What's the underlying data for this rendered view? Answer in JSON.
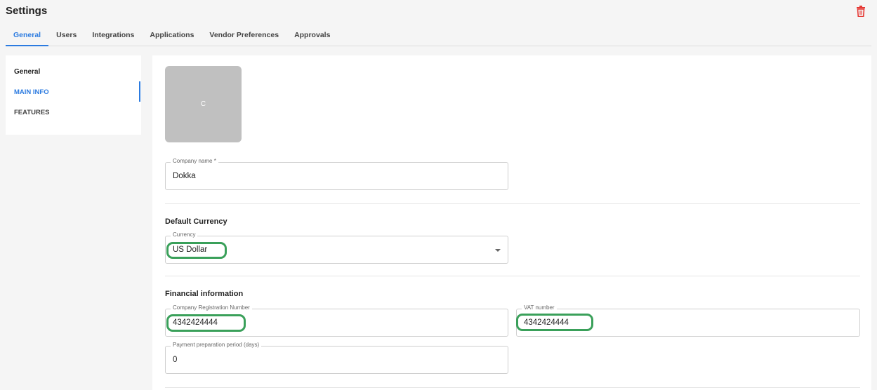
{
  "header": {
    "title": "Settings",
    "delete_icon": "trash-icon",
    "delete_icon_color": "#e53935"
  },
  "tabs": [
    {
      "label": "General",
      "active": true
    },
    {
      "label": "Users"
    },
    {
      "label": "Integrations"
    },
    {
      "label": "Applications"
    },
    {
      "label": "Vendor Preferences"
    },
    {
      "label": "Approvals"
    }
  ],
  "sidebar": {
    "heading": "General",
    "items": [
      {
        "label": "MAIN INFO",
        "active": true
      },
      {
        "label": "FEATURES"
      }
    ]
  },
  "main": {
    "logo_letter": "C",
    "company_name": {
      "label": "Company name *",
      "value": "Dokka"
    },
    "default_currency": {
      "section_title": "Default Currency",
      "label": "Currency",
      "value": "US Dollar"
    },
    "financial": {
      "section_title": "Financial information",
      "registration": {
        "label": "Company Registration Number",
        "value": "4342424444"
      },
      "vat": {
        "label": "VAT number",
        "value": "4342424444"
      },
      "payment_period": {
        "label": "Payment preparation period (days)",
        "value": "0"
      }
    }
  },
  "colors": {
    "accent": "#2c7be0",
    "highlight": "#3aa05a"
  }
}
